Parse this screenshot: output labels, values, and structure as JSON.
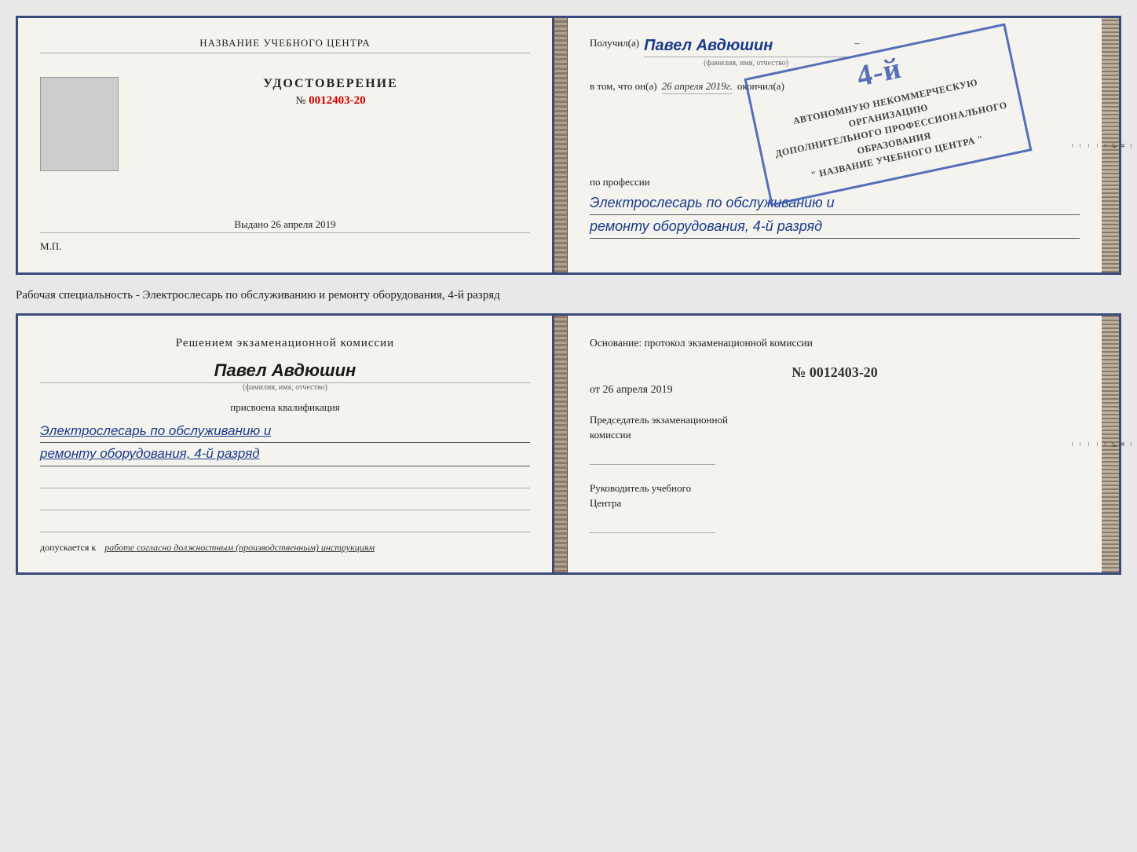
{
  "top_cert": {
    "left": {
      "training_center": "НАЗВАНИЕ УЧЕБНОГО ЦЕНТРА",
      "cert_title": "УДОСТОВЕРЕНИЕ",
      "cert_number_prefix": "№",
      "cert_number": "0012403-20",
      "issued_label": "Выдано",
      "issued_date": "26 апреля 2019",
      "mp_label": "М.П."
    },
    "right": {
      "recipient_prefix": "Получил(а)",
      "recipient_name": "Павел Авдюшин",
      "fio_hint": "(фамилия, имя, отчество)",
      "vtom_prefix": "в том, что он(а)",
      "vtom_date": "26 апреля 2019г.",
      "okonchil": "окончил(а)",
      "grade_label": "4-й",
      "org_line1": "АВТОНОМНУЮ НЕКОММЕРЧЕСКУЮ ОРГАНИЗАЦИЮ",
      "org_line2": "ДОПОЛНИТЕЛЬНОГО ПРОФЕССИОНАЛЬНОГО ОБРАЗОВАНИЯ",
      "org_line3": "\" НАЗВАНИЕ УЧЕБНОГО ЦЕНТРА \"",
      "profession_prefix": "по профессии",
      "profession_value1": "Электрослесарь по обслуживанию и",
      "profession_value2": "ремонту оборудования, 4-й разряд",
      "dash1": "–",
      "dash2": "–",
      "dash3": "–",
      "dash4": "и",
      "dash5": ",а",
      "dash6": "←",
      "dash7": "–",
      "dash8": "–",
      "dash9": "–",
      "dash10": "–"
    }
  },
  "between_text": "Рабочая специальность - Электрослесарь по обслуживанию и ремонту оборудования, 4-й разряд",
  "bottom_cert": {
    "left": {
      "decision_title": "Решением экзаменационной комиссии",
      "person_name": "Павел Авдюшин",
      "fio_hint": "(фамилия, имя, отчество)",
      "assigned_label": "присвоена квалификация",
      "qualification_line1": "Электрослесарь по обслуживанию и",
      "qualification_line2": "ремонту оборудования, 4-й разряд",
      "допускается_label": "допускается к",
      "допускается_value": "работе согласно должностным (производственным) инструкциям"
    },
    "right": {
      "osnование_label": "Основание: протокол экзаменационной комиссии",
      "protocol_prefix": "№",
      "protocol_number": "0012403-20",
      "date_prefix": "от",
      "protocol_date": "26 апреля 2019",
      "chairman_label1": "Председатель экзаменационной",
      "chairman_label2": "комиссии",
      "head_label1": "Руководитель учебного",
      "head_label2": "Центра",
      "dash1": "–",
      "dash2": "–",
      "dash3": "–",
      "dash4": "и",
      "dash5": ",а",
      "dash6": "←",
      "dash7": "–",
      "dash8": "–",
      "dash9": "–",
      "dash10": "–"
    }
  }
}
